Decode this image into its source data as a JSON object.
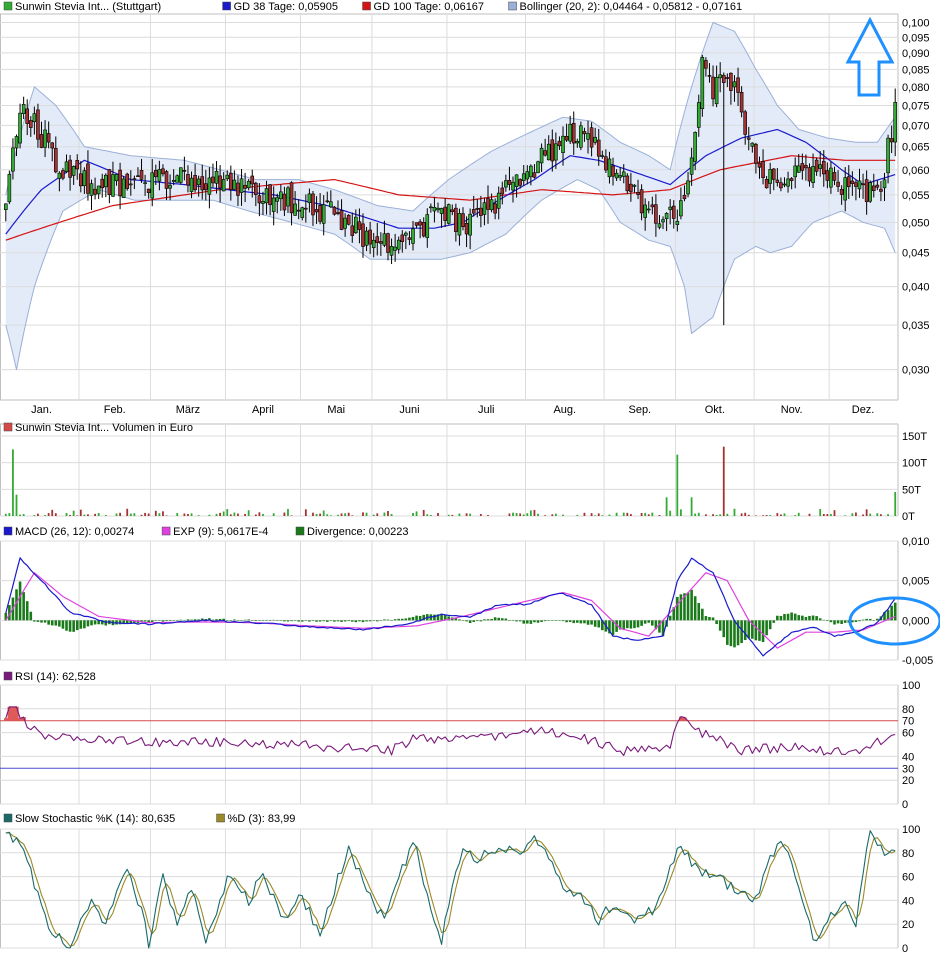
{
  "colors": {
    "grid": "#dcdcdc",
    "frame": "#bfbfbf",
    "up_candle": "#33aa33",
    "down_candle": "#a53232",
    "gd38": "#1a1acc",
    "gd100": "#d41414",
    "bollinger_fill": "#e4ebf8",
    "bollinger_line": "#9ab0d8",
    "macd": "#1a1acc",
    "signal": "#e040e0",
    "divergence": "#1a7a1a",
    "rsi_line": "#7a1a7a",
    "rsi_70": "#d44a4a",
    "rsi_30": "#4a4ad4",
    "stoch_k": "#1a6a6a",
    "stoch_d": "#9a8a2a",
    "annotation": "#1e90ff"
  },
  "months": [
    "Jan.",
    "Feb.",
    "März",
    "April",
    "Mai",
    "Juni",
    "Juli",
    "Aug.",
    "Sep.",
    "Okt.",
    "Nov.",
    "Dez."
  ],
  "annotations": {
    "arrow_icon": "up-arrow-icon",
    "ellipse_icon": "highlight-ellipse-icon"
  },
  "chart_data": [
    {
      "type": "candlestick",
      "legend": [
        {
          "label": "Sunwin Stevia Int... (Stuttgart)",
          "color": "#33aa33"
        },
        {
          "label": "GD 38 Tage: 0,05905",
          "color": "#1a1acc"
        },
        {
          "label": "GD 100 Tage: 0,06167",
          "color": "#d41414"
        },
        {
          "label": "Bollinger (20, 2): 0,04464 - 0,05812 - 0,07161",
          "color": "#9ab0d8"
        }
      ],
      "y_scale": "log",
      "ylim": [
        0.027,
        0.103
      ],
      "yticks": [
        "0,100",
        "0,095",
        "0,090",
        "0,085",
        "0,080",
        "0,075",
        "0,070",
        "0,065",
        "0,060",
        "0,055",
        "0,050",
        "0,045",
        "0,040",
        "0,035",
        "0,030"
      ],
      "close_anchors": [
        [
          0,
          0.055
        ],
        [
          4,
          0.075
        ],
        [
          8,
          0.07
        ],
        [
          14,
          0.062
        ],
        [
          20,
          0.058
        ],
        [
          30,
          0.057
        ],
        [
          45,
          0.058
        ],
        [
          60,
          0.058
        ],
        [
          70,
          0.056
        ],
        [
          80,
          0.054
        ],
        [
          90,
          0.052
        ],
        [
          100,
          0.048
        ],
        [
          108,
          0.047
        ],
        [
          114,
          0.047
        ],
        [
          120,
          0.052
        ],
        [
          128,
          0.05
        ],
        [
          135,
          0.052
        ],
        [
          142,
          0.058
        ],
        [
          150,
          0.062
        ],
        [
          158,
          0.068
        ],
        [
          164,
          0.066
        ],
        [
          170,
          0.06
        ],
        [
          176,
          0.055
        ],
        [
          182,
          0.052
        ],
        [
          188,
          0.05
        ],
        [
          192,
          0.06
        ],
        [
          195,
          0.086
        ],
        [
          198,
          0.08
        ],
        [
          204,
          0.08
        ],
        [
          210,
          0.06
        ],
        [
          216,
          0.057
        ],
        [
          222,
          0.06
        ],
        [
          230,
          0.058
        ],
        [
          238,
          0.057
        ],
        [
          244,
          0.055
        ],
        [
          246,
          0.06
        ],
        [
          249,
          0.073
        ]
      ],
      "gd38_anchors": [
        [
          0,
          0.048
        ],
        [
          10,
          0.056
        ],
        [
          22,
          0.062
        ],
        [
          35,
          0.058
        ],
        [
          50,
          0.057
        ],
        [
          62,
          0.056
        ],
        [
          75,
          0.055
        ],
        [
          90,
          0.053
        ],
        [
          100,
          0.051
        ],
        [
          110,
          0.049
        ],
        [
          120,
          0.049
        ],
        [
          128,
          0.05
        ],
        [
          138,
          0.054
        ],
        [
          148,
          0.058
        ],
        [
          158,
          0.063
        ],
        [
          166,
          0.062
        ],
        [
          178,
          0.059
        ],
        [
          186,
          0.057
        ],
        [
          196,
          0.063
        ],
        [
          206,
          0.067
        ],
        [
          216,
          0.069
        ],
        [
          224,
          0.066
        ],
        [
          234,
          0.06
        ],
        [
          240,
          0.057
        ],
        [
          249,
          0.059
        ]
      ],
      "gd100_anchors": [
        [
          0,
          0.047
        ],
        [
          30,
          0.053
        ],
        [
          60,
          0.056
        ],
        [
          92,
          0.058
        ],
        [
          110,
          0.055
        ],
        [
          130,
          0.054
        ],
        [
          150,
          0.056
        ],
        [
          170,
          0.055
        ],
        [
          186,
          0.056
        ],
        [
          200,
          0.06
        ],
        [
          220,
          0.063
        ],
        [
          235,
          0.062
        ],
        [
          249,
          0.062
        ]
      ],
      "boll_upper_anchors": [
        [
          0,
          0.055
        ],
        [
          8,
          0.08
        ],
        [
          14,
          0.075
        ],
        [
          22,
          0.065
        ],
        [
          35,
          0.063
        ],
        [
          50,
          0.062
        ],
        [
          60,
          0.06
        ],
        [
          70,
          0.058
        ],
        [
          82,
          0.058
        ],
        [
          92,
          0.056
        ],
        [
          104,
          0.053
        ],
        [
          114,
          0.052
        ],
        [
          124,
          0.058
        ],
        [
          136,
          0.064
        ],
        [
          146,
          0.068
        ],
        [
          156,
          0.072
        ],
        [
          164,
          0.071
        ],
        [
          172,
          0.066
        ],
        [
          180,
          0.063
        ],
        [
          186,
          0.06
        ],
        [
          192,
          0.08
        ],
        [
          198,
          0.1
        ],
        [
          204,
          0.097
        ],
        [
          210,
          0.085
        ],
        [
          216,
          0.075
        ],
        [
          222,
          0.069
        ],
        [
          230,
          0.067
        ],
        [
          238,
          0.066
        ],
        [
          244,
          0.066
        ],
        [
          249,
          0.072
        ]
      ],
      "boll_lower_anchors": [
        [
          0,
          0.035
        ],
        [
          3,
          0.03
        ],
        [
          8,
          0.04
        ],
        [
          16,
          0.052
        ],
        [
          26,
          0.056
        ],
        [
          36,
          0.054
        ],
        [
          46,
          0.054
        ],
        [
          58,
          0.054
        ],
        [
          68,
          0.052
        ],
        [
          80,
          0.05
        ],
        [
          92,
          0.048
        ],
        [
          102,
          0.044
        ],
        [
          112,
          0.044
        ],
        [
          122,
          0.044
        ],
        [
          130,
          0.045
        ],
        [
          140,
          0.048
        ],
        [
          150,
          0.054
        ],
        [
          160,
          0.058
        ],
        [
          166,
          0.056
        ],
        [
          172,
          0.05
        ],
        [
          180,
          0.047
        ],
        [
          186,
          0.046
        ],
        [
          190,
          0.04
        ],
        [
          192,
          0.034
        ],
        [
          198,
          0.036
        ],
        [
          204,
          0.044
        ],
        [
          210,
          0.046
        ],
        [
          214,
          0.045
        ],
        [
          220,
          0.046
        ],
        [
          226,
          0.05
        ],
        [
          234,
          0.052
        ],
        [
          240,
          0.05
        ],
        [
          246,
          0.049
        ],
        [
          249,
          0.045
        ]
      ],
      "special_candles": [
        {
          "bar": 201,
          "low": 0.035
        }
      ]
    },
    {
      "type": "bar",
      "legend": [
        {
          "label": "Sunwin Stevia Int... Volumen in Euro",
          "color": "#d44a4a"
        }
      ],
      "yticks": [
        "150T",
        "100T",
        "50T",
        "0T"
      ],
      "ylim": [
        0,
        150
      ],
      "unit": "T",
      "spikes": [
        [
          2,
          125,
          "up"
        ],
        [
          3,
          40,
          "up"
        ],
        [
          185,
          35,
          "up"
        ],
        [
          188,
          115,
          "up"
        ],
        [
          192,
          35,
          "up"
        ],
        [
          201,
          130,
          "down"
        ],
        [
          249,
          45,
          "up"
        ]
      ]
    },
    {
      "type": "line+bar",
      "legend": [
        {
          "label": "MACD (26, 12): 0,00274",
          "color": "#1a1acc"
        },
        {
          "label": "EXP (9): 5,0617E-4",
          "color": "#e040e0"
        },
        {
          "label": "Divergence: 0,00223",
          "color": "#1a7a1a"
        }
      ],
      "ylim": [
        -0.005,
        0.01
      ],
      "yticks": [
        "0,010",
        "0,005",
        "0,000",
        "-0,005"
      ],
      "macd_anchors": [
        [
          0,
          0.001
        ],
        [
          4,
          0.0078
        ],
        [
          10,
          0.005
        ],
        [
          18,
          0.001
        ],
        [
          28,
          -0.0002
        ],
        [
          40,
          -0.0005
        ],
        [
          55,
          0.0
        ],
        [
          70,
          -0.0003
        ],
        [
          85,
          -0.0008
        ],
        [
          100,
          -0.0012
        ],
        [
          112,
          -0.0005
        ],
        [
          122,
          0.0008
        ],
        [
          130,
          0.0004
        ],
        [
          138,
          0.002
        ],
        [
          146,
          0.002
        ],
        [
          155,
          0.0035
        ],
        [
          164,
          0.002
        ],
        [
          170,
          -0.002
        ],
        [
          176,
          -0.0025
        ],
        [
          184,
          -0.002
        ],
        [
          188,
          0.005
        ],
        [
          192,
          0.0078
        ],
        [
          198,
          0.006
        ],
        [
          204,
          0.0
        ],
        [
          212,
          -0.0045
        ],
        [
          220,
          -0.0015
        ],
        [
          226,
          -0.0008
        ],
        [
          232,
          -0.002
        ],
        [
          238,
          -0.0015
        ],
        [
          244,
          -0.0003
        ],
        [
          249,
          0.0027
        ]
      ],
      "signal_anchors": [
        [
          0,
          0.0
        ],
        [
          8,
          0.006
        ],
        [
          16,
          0.003
        ],
        [
          26,
          0.0005
        ],
        [
          40,
          -0.0003
        ],
        [
          55,
          -0.0002
        ],
        [
          70,
          -0.0003
        ],
        [
          85,
          -0.0007
        ],
        [
          100,
          -0.001
        ],
        [
          115,
          -0.0007
        ],
        [
          128,
          0.0005
        ],
        [
          140,
          0.0018
        ],
        [
          156,
          0.0035
        ],
        [
          164,
          0.0025
        ],
        [
          172,
          -0.001
        ],
        [
          180,
          -0.002
        ],
        [
          188,
          0.002
        ],
        [
          196,
          0.006
        ],
        [
          202,
          0.005
        ],
        [
          208,
          0.0
        ],
        [
          216,
          -0.0035
        ],
        [
          224,
          -0.0015
        ],
        [
          232,
          -0.0015
        ],
        [
          240,
          -0.0012
        ],
        [
          249,
          0.0005
        ]
      ],
      "divergence_value": 0.00223
    },
    {
      "type": "line",
      "legend": [
        {
          "label": "RSI (14): 62,528",
          "color": "#7a1a7a"
        }
      ],
      "ylim": [
        0,
        100
      ],
      "yticks": [
        "100",
        "80",
        "70",
        "60",
        "40",
        "30",
        "20",
        "0"
      ],
      "levels": [
        70,
        30
      ],
      "rsi_anchors": [
        [
          0,
          75
        ],
        [
          2,
          82
        ],
        [
          5,
          70
        ],
        [
          10,
          58
        ],
        [
          20,
          55
        ],
        [
          40,
          52
        ],
        [
          60,
          52
        ],
        [
          80,
          50
        ],
        [
          95,
          47
        ],
        [
          108,
          45
        ],
        [
          116,
          58
        ],
        [
          122,
          52
        ],
        [
          132,
          56
        ],
        [
          140,
          58
        ],
        [
          150,
          62
        ],
        [
          158,
          58
        ],
        [
          166,
          52
        ],
        [
          172,
          44
        ],
        [
          180,
          46
        ],
        [
          186,
          50
        ],
        [
          189,
          75
        ],
        [
          193,
          62
        ],
        [
          198,
          56
        ],
        [
          206,
          45
        ],
        [
          220,
          48
        ],
        [
          232,
          44
        ],
        [
          240,
          46
        ],
        [
          246,
          55
        ],
        [
          249,
          62
        ]
      ]
    },
    {
      "type": "line",
      "legend": [
        {
          "label": "Slow Stochastic %K (14): 80,635",
          "color": "#1a6a6a"
        },
        {
          "label": "%D (3): 83,99",
          "color": "#9a8a2a"
        }
      ],
      "ylim": [
        0,
        100
      ],
      "yticks": [
        "100",
        "80",
        "60",
        "40",
        "20",
        "0"
      ],
      "k_anchors": [
        [
          0,
          98
        ],
        [
          4,
          88
        ],
        [
          8,
          55
        ],
        [
          12,
          18
        ],
        [
          18,
          2
        ],
        [
          24,
          40
        ],
        [
          28,
          20
        ],
        [
          34,
          68
        ],
        [
          38,
          32
        ],
        [
          40,
          2
        ],
        [
          44,
          62
        ],
        [
          48,
          18
        ],
        [
          52,
          50
        ],
        [
          56,
          8
        ],
        [
          62,
          58
        ],
        [
          68,
          40
        ],
        [
          72,
          62
        ],
        [
          78,
          22
        ],
        [
          82,
          48
        ],
        [
          88,
          12
        ],
        [
          96,
          85
        ],
        [
          100,
          55
        ],
        [
          106,
          22
        ],
        [
          114,
          92
        ],
        [
          118,
          45
        ],
        [
          122,
          8
        ],
        [
          128,
          88
        ],
        [
          132,
          70
        ],
        [
          136,
          85
        ],
        [
          142,
          80
        ],
        [
          148,
          90
        ],
        [
          152,
          78
        ],
        [
          156,
          52
        ],
        [
          162,
          40
        ],
        [
          166,
          22
        ],
        [
          170,
          38
        ],
        [
          176,
          20
        ],
        [
          182,
          35
        ],
        [
          188,
          85
        ],
        [
          192,
          72
        ],
        [
          196,
          62
        ],
        [
          200,
          58
        ],
        [
          206,
          45
        ],
        [
          210,
          40
        ],
        [
          216,
          90
        ],
        [
          220,
          75
        ],
        [
          226,
          8
        ],
        [
          230,
          20
        ],
        [
          234,
          40
        ],
        [
          238,
          22
        ],
        [
          242,
          98
        ],
        [
          246,
          80
        ],
        [
          249,
          80
        ]
      ]
    }
  ]
}
